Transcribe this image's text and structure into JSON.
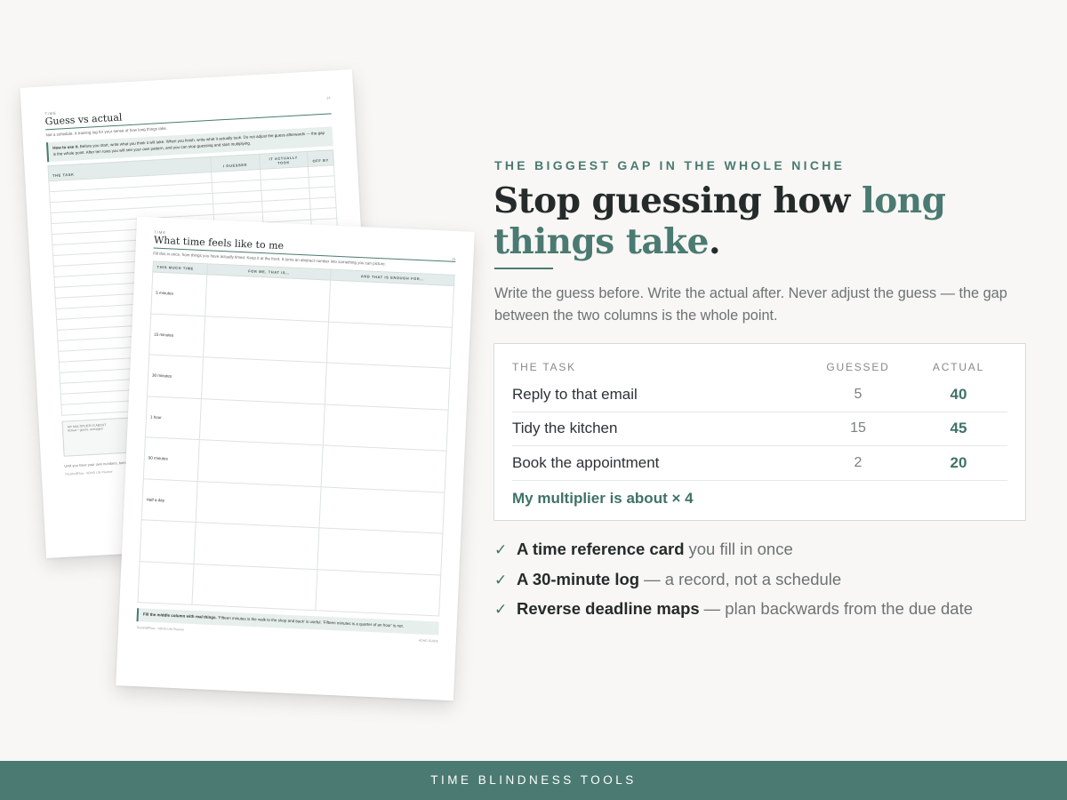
{
  "back_sheet": {
    "kicker": "TIME",
    "page_no": "14",
    "title": "Guess vs actual",
    "subtitle": "Not a schedule. A training log for your sense of how long things take.",
    "note_bold": "How to use it.",
    "note_text": "Before you start, write what you think it will take. When you finish, write what it actually took. Do not adjust the guess afterwards — the gap is the whole point. After ten rows you will see your own pattern, and you can stop guessing and start multiplying.",
    "headers": [
      "THE TASK",
      "I GUESSED",
      "IT ACTUALLY TOOK",
      "OFF BY"
    ],
    "box_label": "MY MULTIPLIER IS ABOUT",
    "box_text": "Actual ÷ guess, averaged",
    "tail_text": "Until you have your own numbers, borrow ours. Most people land between two and four.",
    "footer_left": "TheShelfFlow · ADHD Life Planner"
  },
  "front_sheet": {
    "kicker": "TIME",
    "page_no": "15",
    "title": "What time feels like to me",
    "subtitle": "Fill this in once, from things you have actually timed. Keep it at the front. It turns an abstract number into something you can picture.",
    "headers": [
      "THIS MUCH TIME",
      "FOR ME, THAT IS…",
      "AND THAT IS ENOUGH FOR…"
    ],
    "rows": [
      "5 minutes",
      "15 minutes",
      "30 minutes",
      "1 hour",
      "90 minutes",
      "Half a day",
      "",
      ""
    ],
    "note_bold": "Fill the middle column with real things.",
    "note_text": "'Fifteen minutes is the walk to the shop and back' is useful. 'Fifteen minutes is a quarter of an hour' is not.",
    "footer_left": "TheShelfFlow · ADHD Life Planner",
    "footer_right": "ADHD GUIDE"
  },
  "hero": {
    "kicker": "THE BIGGEST GAP IN THE WHOLE NICHE",
    "headline_plain": "Stop guessing how ",
    "headline_accent": "long things take",
    "headline_end": ".",
    "intro": "Write the guess before. Write the actual after. Never adjust the guess — the gap between the two columns is the whole point."
  },
  "card": {
    "headers": {
      "task": "THE TASK",
      "guessed": "GUESSED",
      "actual": "ACTUAL"
    },
    "rows": [
      {
        "task": "Reply to that email",
        "guessed": "5",
        "actual": "40"
      },
      {
        "task": "Tidy the kitchen",
        "guessed": "15",
        "actual": "45"
      },
      {
        "task": "Book the appointment",
        "guessed": "2",
        "actual": "20"
      }
    ],
    "multiplier": "My multiplier is about × 4"
  },
  "features": [
    {
      "check": "✓",
      "bold": "A time reference card",
      "rest": "you fill in once"
    },
    {
      "check": "✓",
      "bold": "A 30-minute log",
      "rest": "— a record, not a schedule"
    },
    {
      "check": "✓",
      "bold": "Reverse deadline maps",
      "rest": "— plan backwards from the due date"
    }
  ],
  "footer": {
    "label": "TIME BLINDNESS TOOLS"
  },
  "colors": {
    "accent": "#4a7a71",
    "background": "#f8f7f5",
    "ink": "#252b2b"
  }
}
